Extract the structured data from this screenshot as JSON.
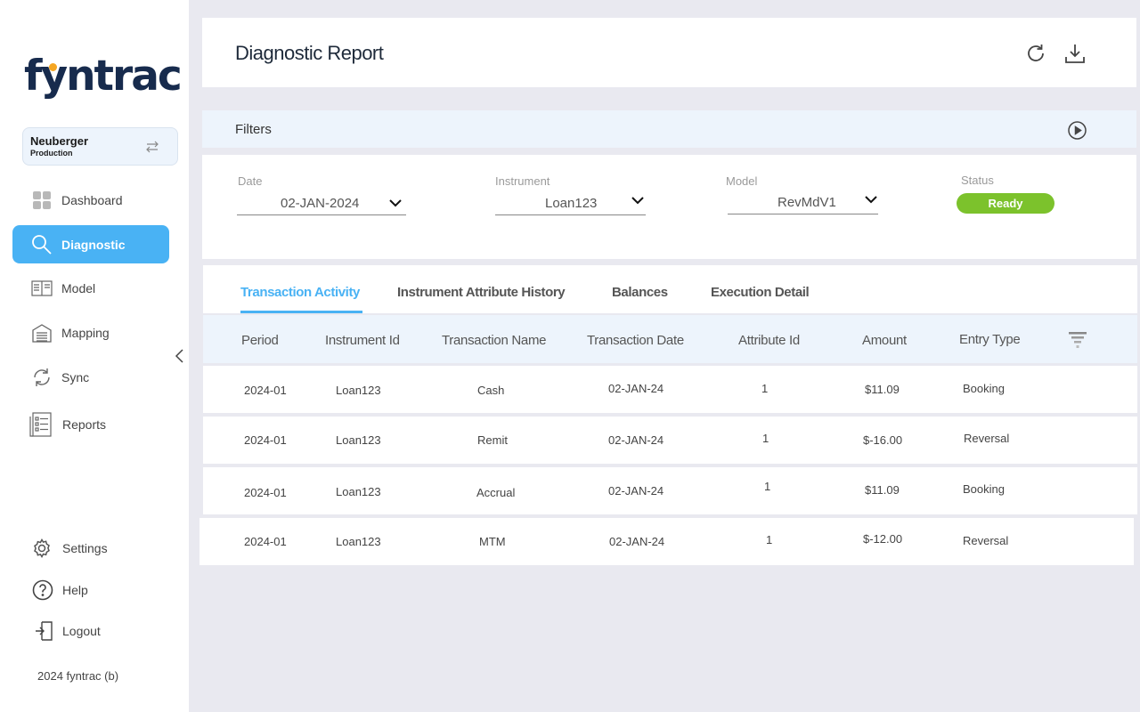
{
  "sidebar": {
    "brand": "fyntrac",
    "org": {
      "name": "Neuberger",
      "env": "Production"
    },
    "nav": [
      {
        "label": "Dashboard",
        "icon": "dashboard-icon"
      },
      {
        "label": "Diagnostic",
        "icon": "search-icon",
        "active": true
      },
      {
        "label": "Model",
        "icon": "book-icon"
      },
      {
        "label": "Mapping",
        "icon": "building-icon"
      },
      {
        "label": "Sync",
        "icon": "sync-icon"
      },
      {
        "label": "Reports",
        "icon": "reports-icon"
      }
    ],
    "bottom_nav": [
      {
        "label": "Settings",
        "icon": "gear-icon"
      },
      {
        "label": "Help",
        "icon": "help-icon"
      },
      {
        "label": "Logout",
        "icon": "logout-icon"
      }
    ],
    "footer": "2024 fyntrac (b)"
  },
  "header": {
    "title": "Diagnostic Report"
  },
  "filters": {
    "title": "Filters",
    "date": {
      "label": "Date",
      "value": "02-JAN-2024"
    },
    "instrument": {
      "label": "Instrument",
      "value": "Loan123"
    },
    "model": {
      "label": "Model",
      "value": "RevMdV1"
    },
    "status": {
      "label": "Status",
      "value": "Ready"
    }
  },
  "tabs": [
    "Transaction Activity",
    "Instrument Attribute History",
    "Balances",
    "Execution Detail"
  ],
  "table": {
    "columns": [
      "Period",
      "Instrument Id",
      "Transaction Name",
      "Transaction Date",
      "Attribute Id",
      "Amount",
      "Entry Type"
    ],
    "rows": [
      [
        "2024-01",
        "Loan123",
        "Cash",
        "02-JAN-24",
        "1",
        "$11.09",
        "Booking"
      ],
      [
        "2024-01",
        "Loan123",
        "Remit",
        "02-JAN-24",
        "1",
        "$-16.00",
        "Reversal"
      ],
      [
        "2024-01",
        "Loan123",
        "Accrual",
        "02-JAN-24",
        "1",
        "$11.09",
        "Booking"
      ],
      [
        "2024-01",
        "Loan123",
        "MTM",
        "02-JAN-24",
        "1",
        "$-12.00",
        "Reversal"
      ]
    ]
  },
  "colors": {
    "accent": "#49b2f4",
    "status_ready": "#7cc22c",
    "brand_dark": "#172b4d",
    "brand_dot": "#f5a623"
  }
}
